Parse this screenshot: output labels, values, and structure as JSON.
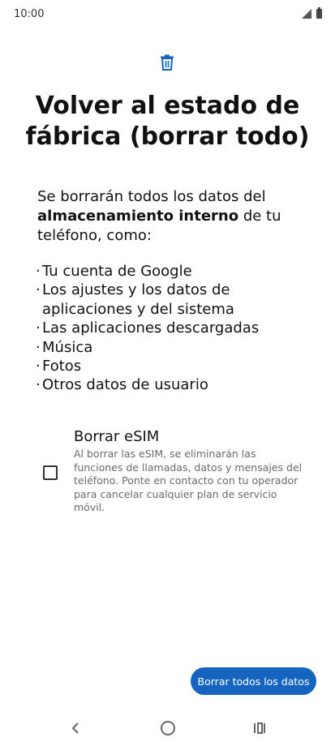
{
  "status_bar": {
    "time": "10:00"
  },
  "icons": {
    "header": "trash-icon"
  },
  "title": "Volver al estado de fábrica (borrar todo)",
  "description": {
    "prefix": "Se borrarán todos los datos del ",
    "bold": "almacenamiento interno",
    "suffix": " de tu teléfono, como:"
  },
  "items": [
    "Tu cuenta de Google",
    "Los ajustes y los datos de aplicaciones y del sistema",
    "Las aplicaciones descargadas",
    "Música",
    "Fotos",
    "Otros datos de usuario"
  ],
  "esim": {
    "title": "Borrar eSIM",
    "description": "Al borrar las eSIM, se eliminarán las funciones de llamadas, datos y mensajes del teléfono. Ponte en contacto con tu operador para cancelar cualquier plan de servicio móvil.",
    "checked": false
  },
  "button": {
    "label": "Borrar todos los datos"
  },
  "colors": {
    "accent": "#1565c0",
    "header_icon": "#1565c0"
  }
}
